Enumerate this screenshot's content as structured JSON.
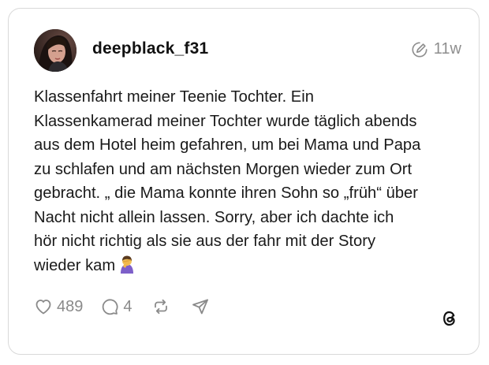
{
  "post": {
    "username": "deepblack_f31",
    "time": "11w",
    "text_lines": [
      "Klassenfahrt meiner Teenie Tochter. Ein",
      "Klassenkamerad meiner Tochter wurde täglich abends",
      "aus dem Hotel heim gefahren, um bei Mama und Papa",
      "zu schlafen und am nächsten Morgen wieder zum Ort",
      "gebracht. „ die Mama konnte ihren Sohn so „früh“ über",
      "Nacht nicht allein lassen. Sorry, aber ich dachte ich",
      "hör nicht richtig als sie aus der fahr mit der Story",
      "wieder kam"
    ],
    "emoji": "person-facepalming-emoji"
  },
  "actions": {
    "likes": "489",
    "comments": "4",
    "like_icon": "heart-icon",
    "comment_icon": "comment-icon",
    "repost_icon": "repost-icon",
    "share_icon": "send-icon"
  },
  "icons": {
    "meta": "edited-icon",
    "brand": "threads-logo-icon"
  },
  "colors": {
    "text": "#1a1a1a",
    "muted": "#8e8e8e",
    "border": "#d9d9d9"
  }
}
